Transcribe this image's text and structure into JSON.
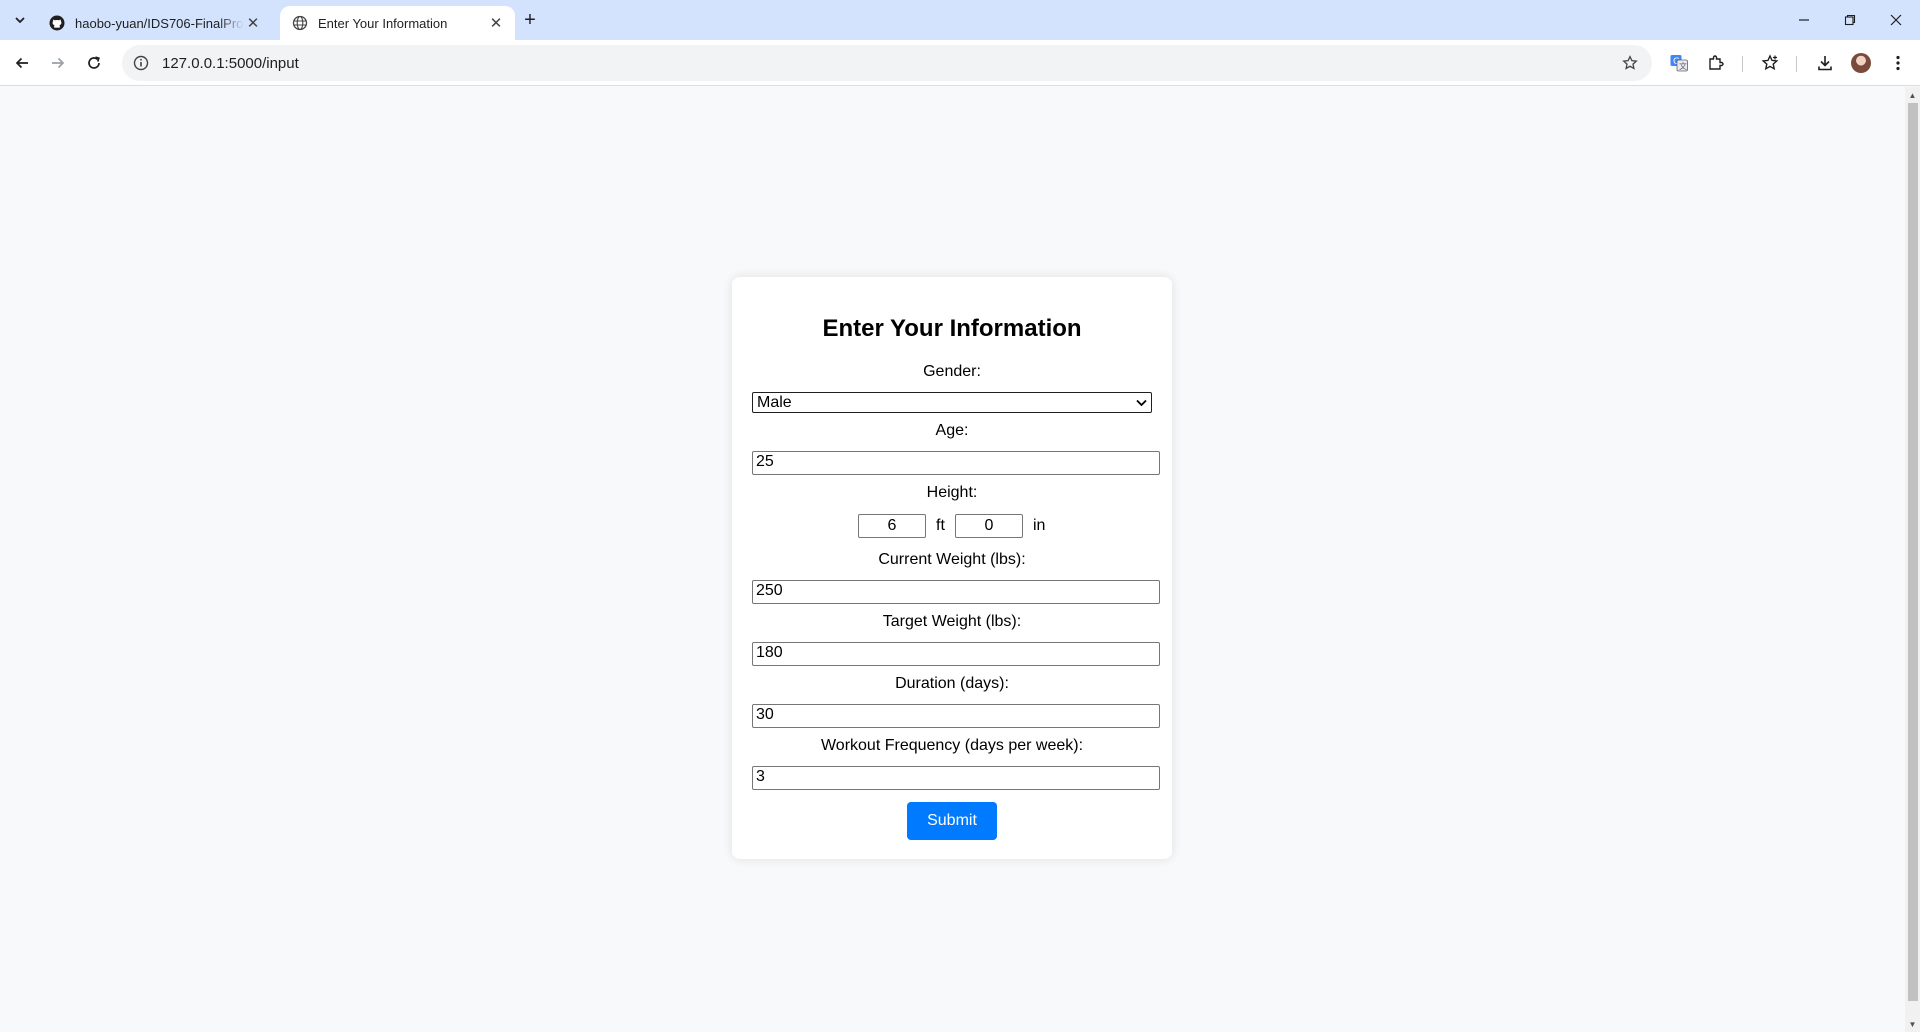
{
  "browser": {
    "tabs": [
      {
        "title": "haobo-yuan/IDS706-FinalProject",
        "active": false,
        "favicon": "github-icon"
      },
      {
        "title": "Enter Your Information",
        "active": true,
        "favicon": "globe-icon"
      }
    ],
    "url": "127.0.0.1:5000/input"
  },
  "form": {
    "title": "Enter Your Information",
    "gender": {
      "label": "Gender:",
      "value": "Male"
    },
    "age": {
      "label": "Age:",
      "value": "25"
    },
    "height": {
      "label": "Height:",
      "feet": "6",
      "feet_unit": "ft",
      "inches": "0",
      "inches_unit": "in"
    },
    "current_weight": {
      "label": "Current Weight (lbs):",
      "value": "250"
    },
    "target_weight": {
      "label": "Target Weight (lbs):",
      "value": "180"
    },
    "duration": {
      "label": "Duration (days):",
      "value": "30"
    },
    "workout_frequency": {
      "label": "Workout Frequency (days per week):",
      "value": "3"
    },
    "submit_label": "Submit"
  },
  "colors": {
    "accent": "#007bff",
    "tabstrip": "#d3e3fd",
    "page_background": "#f8f9fa"
  }
}
